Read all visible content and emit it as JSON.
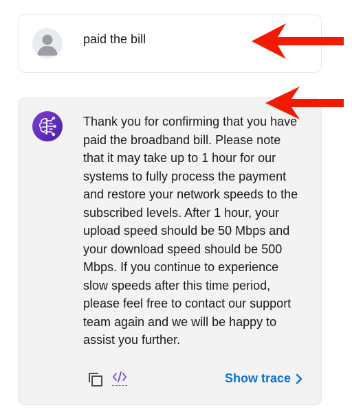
{
  "user_message": {
    "avatar_icon": "user-avatar-icon",
    "text": "paid the bill"
  },
  "bot_message": {
    "avatar_icon": "ai-brain-circuit-icon",
    "text": "Thank you for confirming that you have paid the broadband bill. Please note that it may take up to 1 hour for our systems to fully process the payment and restore your network speeds to the subscribed levels. After 1 hour, your upload speed should be 50 Mbps and your download speed should be 500 Mbps. If you continue to experience slow speeds after this time period, please feel free to contact our support team again and we will be happy to assist you further.",
    "copy_icon": "copy-icon",
    "code_icon": "code-icon",
    "show_trace_label": "Show trace",
    "show_trace_icon": "chevron-right-icon"
  },
  "annotations": {
    "arrow_color": "#f21a00",
    "arrow_icon": "red-arrow-icon"
  },
  "colors": {
    "link": "#0972d3",
    "bot_bg": "#f3f3f4",
    "border": "#e3e6e9"
  }
}
